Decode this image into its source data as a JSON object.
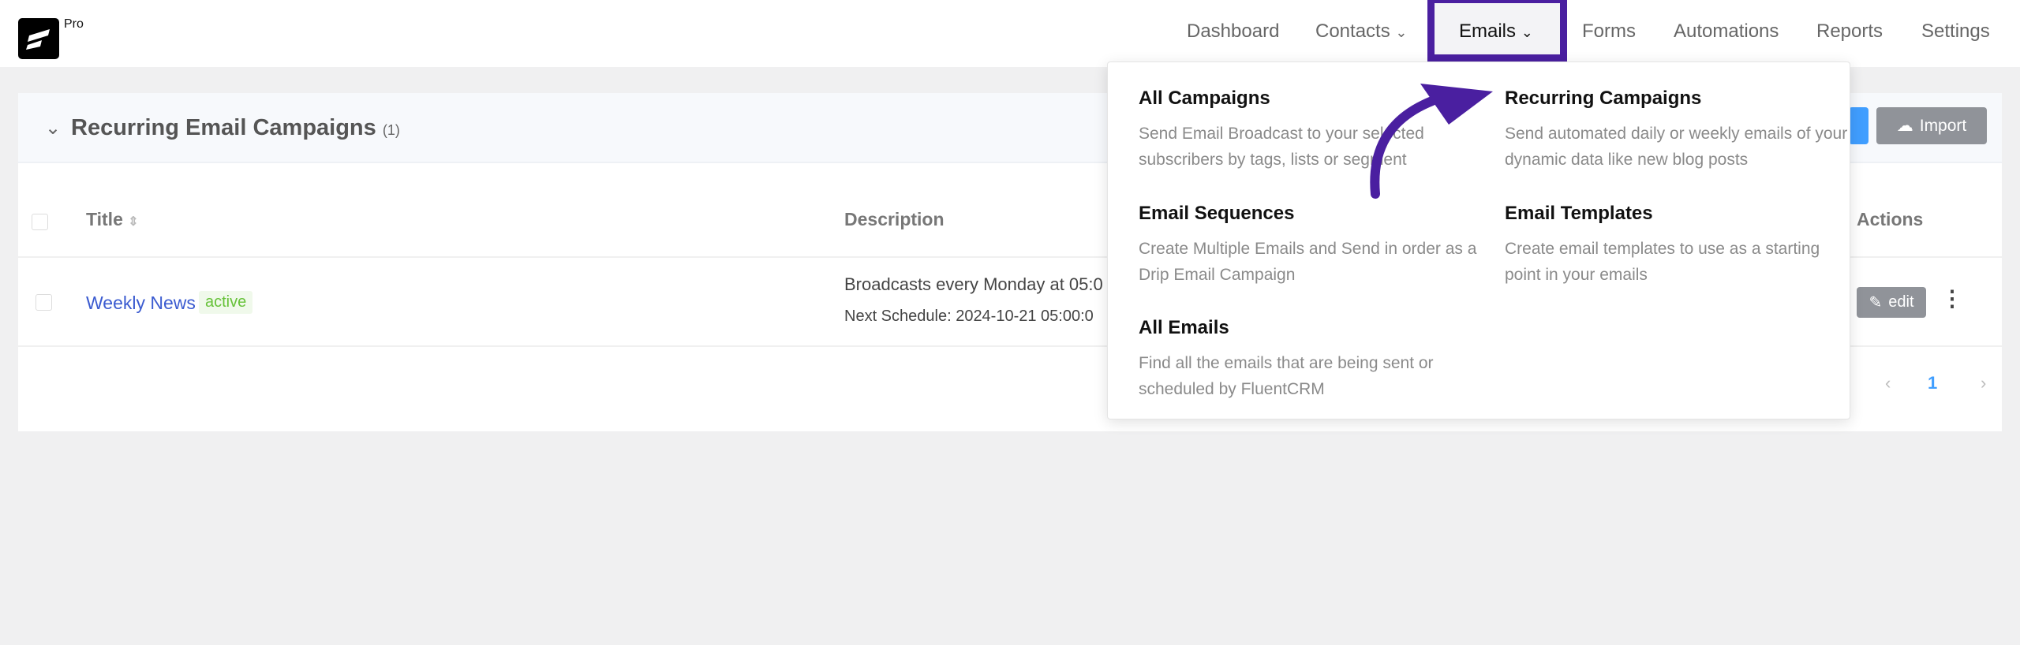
{
  "brand": {
    "badge": "Pro"
  },
  "nav": [
    {
      "label": "Dashboard"
    },
    {
      "label": "Contacts"
    },
    {
      "label": "Emails"
    },
    {
      "label": "Forms"
    },
    {
      "label": "Automations"
    },
    {
      "label": "Reports"
    },
    {
      "label": "Settings"
    }
  ],
  "page": {
    "title": "Recurring Email Campaigns",
    "count": "(1)",
    "import_label": "Import"
  },
  "table": {
    "headers": {
      "title": "Title",
      "description": "Description",
      "actions": "Actions"
    },
    "rows": [
      {
        "title": "Weekly News",
        "status": "active",
        "description": "Broadcasts every Monday at 05:0",
        "next": "Next Schedule: 2024-10-21 05:00:0",
        "edit": "edit"
      }
    ]
  },
  "pagination": {
    "current": "1"
  },
  "menu": [
    {
      "title": "All Campaigns",
      "desc": "Send Email Broadcast to your selected subscribers by tags, lists or segment"
    },
    {
      "title": "Recurring Campaigns",
      "desc": "Send automated daily or weekly emails of your dynamic data like new blog posts"
    },
    {
      "title": "Email Sequences",
      "desc": "Create Multiple Emails and Send in order as a Drip Email Campaign"
    },
    {
      "title": "Email Templates",
      "desc": "Create email templates to use as a starting point in your emails"
    },
    {
      "title": "All Emails",
      "desc": "Find all the emails that are being sent or scheduled by FluentCRM"
    }
  ],
  "colors": {
    "accent": "#4a1fa0",
    "link": "#3b5bd0",
    "active": "#67c23a",
    "primary": "#409eff"
  }
}
